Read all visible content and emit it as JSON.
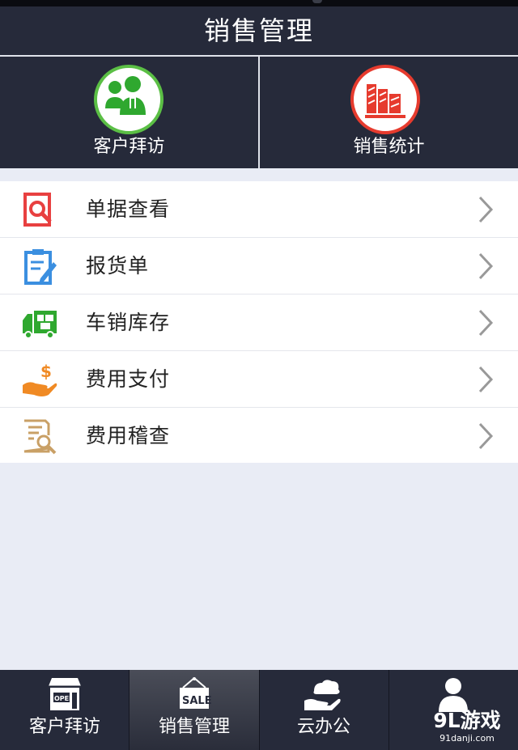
{
  "header": {
    "title": "销售管理"
  },
  "quick_actions": [
    {
      "label": "客户拜访",
      "icon": "customer-visit-icon",
      "accent": "#5bbf45"
    },
    {
      "label": "销售统计",
      "icon": "sales-stats-icon",
      "accent": "#e63b2e"
    }
  ],
  "menu": [
    {
      "label": "单据查看",
      "icon": "document-search-icon",
      "color": "#e84040"
    },
    {
      "label": "报货单",
      "icon": "clipboard-edit-icon",
      "color": "#3b8fe0"
    },
    {
      "label": "车销库存",
      "icon": "delivery-truck-icon",
      "color": "#2fa82f"
    },
    {
      "label": "费用支付",
      "icon": "hand-dollar-icon",
      "color": "#f08a24"
    },
    {
      "label": "费用稽查",
      "icon": "audit-search-icon",
      "color": "#c9a066"
    }
  ],
  "tabs": [
    {
      "label": "客户拜访",
      "icon": "storefront-open-icon",
      "active": false
    },
    {
      "label": "销售管理",
      "icon": "sale-sign-icon",
      "active": true
    },
    {
      "label": "云办公",
      "icon": "cloud-hand-icon",
      "active": false
    },
    {
      "label": "",
      "icon": "user-icon",
      "active": false
    }
  ],
  "watermark": {
    "logo": "9L游戏",
    "url": "91danji.com"
  }
}
